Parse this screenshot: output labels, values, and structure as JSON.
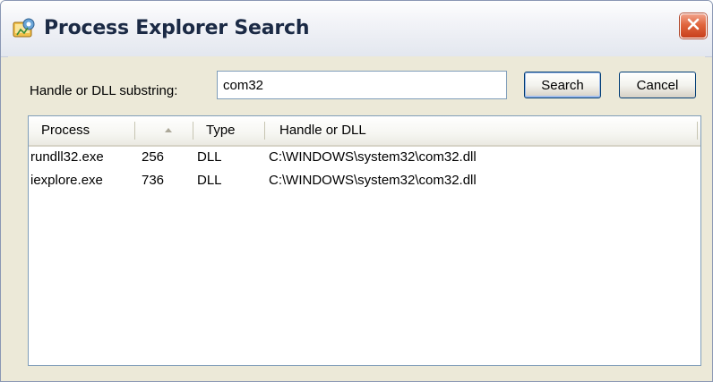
{
  "window": {
    "title": "Process Explorer Search",
    "icon": "process-explorer-icon",
    "close_icon": "close-icon"
  },
  "search": {
    "label": "Handle or DLL substring:",
    "value": "com32",
    "search_button": "Search",
    "cancel_button": "Cancel"
  },
  "results": {
    "columns": [
      "Process",
      "",
      "Type",
      "Handle or DLL"
    ],
    "rows": [
      {
        "process": "rundll32.exe",
        "pid": "256",
        "type": "DLL",
        "handle": "C:\\WINDOWS\\system32\\com32.dll"
      },
      {
        "process": "iexplore.exe",
        "pid": "736",
        "type": "DLL",
        "handle": "C:\\WINDOWS\\system32\\com32.dll"
      }
    ]
  },
  "colors": {
    "titlebar_text": "#1b2a45",
    "close_button": "#e0653d",
    "dialog_background": "#ece9d8",
    "input_border": "#7f9db9"
  }
}
